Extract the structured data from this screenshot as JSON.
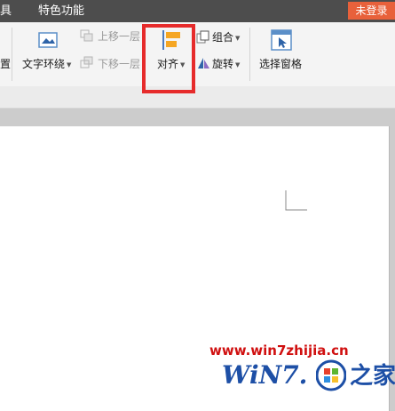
{
  "menubar": {
    "items": [
      "具",
      "特色功能"
    ],
    "login_badge": "未登录"
  },
  "ribbon": {
    "cut_label": "置",
    "text_wrap_label": "文字环绕",
    "move_up_label": "上移一层",
    "move_down_label": "下移一层",
    "align_label": "对齐",
    "group_label": "组合",
    "rotate_label": "旋转",
    "selection_pane_label": "选择窗格"
  },
  "watermark": {
    "url": "www.win7zhijia.cn",
    "logo_text": "WiN7.",
    "logo_suffix": "之家"
  },
  "colors": {
    "menubar": "#4d4d4d",
    "badge": "#e8613b",
    "highlight": "#e62b2b",
    "watermark_red": "#d01010",
    "watermark_blue": "#1d4fa6"
  }
}
